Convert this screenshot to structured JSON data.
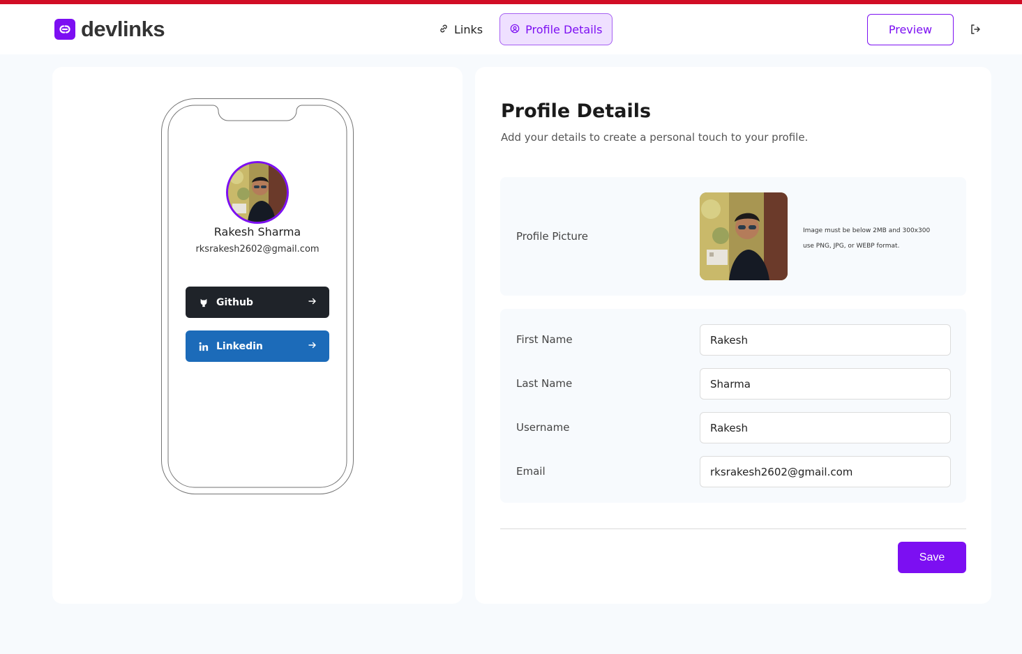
{
  "header": {
    "logo_text": "devlinks",
    "nav": [
      {
        "label": "Links",
        "icon": "link-icon",
        "active": false
      },
      {
        "label": "Profile Details",
        "icon": "user-circle-icon",
        "active": true
      }
    ],
    "preview_label": "Preview",
    "logout_icon": "logout-icon"
  },
  "phone_preview": {
    "name": "Rakesh Sharma",
    "email": "rksrakesh2602@gmail.com",
    "links": [
      {
        "label": "Github",
        "icon": "github-icon",
        "color": "#1f2329"
      },
      {
        "label": "Linkedin",
        "icon": "linkedin-icon",
        "color": "#1c6bb9"
      }
    ]
  },
  "profile": {
    "title": "Profile Details",
    "subtitle": "Add your details to create a personal touch to your profile.",
    "picture_label": "Profile Picture",
    "picture_note_line1": "Image must be below 2MB and 300x300",
    "picture_note_line2": "use PNG, JPG, or WEBP format.",
    "fields": {
      "first_name": {
        "label": "First Name",
        "value": "Rakesh"
      },
      "last_name": {
        "label": "Last Name",
        "value": "Sharma"
      },
      "username": {
        "label": "Username",
        "value": "Rakesh"
      },
      "email": {
        "label": "Email",
        "value": "rksrakesh2602@gmail.com"
      }
    },
    "save_label": "Save"
  },
  "colors": {
    "accent": "#7c0ff2",
    "accent_light": "#efe0ff",
    "top_bar": "#d10d25",
    "github": "#1f2329",
    "linkedin": "#1c6bb9"
  }
}
